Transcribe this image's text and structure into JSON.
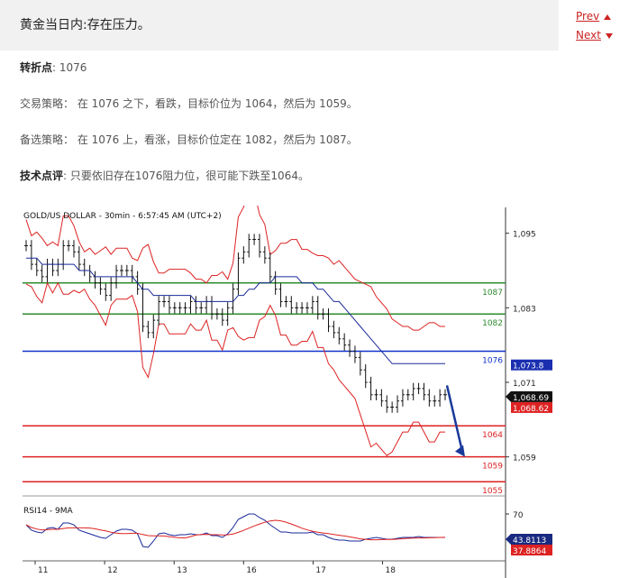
{
  "header": {
    "title": "黄金当日内:存在压力。",
    "prev_label": "Prev",
    "next_label": "Next"
  },
  "content": {
    "pivot_label": "转折点",
    "pivot_value": ": 1076",
    "strategy_label": "交易策略：",
    "strategy_text": "在 1076 之下，看跌，目标价位为 1064，然后为 1059。",
    "alt_label": "备选策略：",
    "alt_text": "在 1076 上，看涨，目标价位定在 1082，然后为 1087。",
    "tech_label": "技术点评",
    "tech_text": ": 只要依旧存在1076阻力位，很可能下跌至1064。"
  },
  "colors": {
    "accent": "#cc2222",
    "resistance": "#2e8b2e",
    "pivot": "#1133cc",
    "support": "#dd2222",
    "band": "#dd2222",
    "ma": "#1a2a99",
    "arrow": "#1a3a9a"
  },
  "chart_data": {
    "type": "line",
    "title": "GOLD/US DOLLAR - 30min - 6:57:45 AM (UTC+2)",
    "ylim": [
      1053,
      1098
    ],
    "yticks": [
      "1,095",
      "1,083",
      "1,071",
      "1,059"
    ],
    "ytick_values": [
      1095,
      1083,
      1071,
      1059
    ],
    "x_labels": [
      "11",
      "12",
      "13",
      "16",
      "17",
      "18"
    ],
    "x_label_positions": [
      2,
      16,
      30,
      44,
      58,
      72
    ],
    "n_bars": 80,
    "levels": [
      {
        "label": "1087",
        "value": 1087,
        "kind": "resistance"
      },
      {
        "label": "1082",
        "value": 1082,
        "kind": "resistance"
      },
      {
        "label": "1076",
        "value": 1076,
        "kind": "pivot"
      },
      {
        "label": "1064",
        "value": 1064,
        "kind": "support"
      },
      {
        "label": "1059",
        "value": 1059,
        "kind": "support"
      },
      {
        "label": "1055",
        "value": 1055,
        "kind": "support"
      }
    ],
    "price_tags": [
      {
        "label": "1,073.8",
        "value": 1073.8,
        "kind": "ma"
      },
      {
        "label": "1,068.69",
        "value": 1068.69,
        "kind": "last"
      },
      {
        "label": "1,068.62",
        "value": 1068.62,
        "kind": "band"
      }
    ],
    "close": [
      1093,
      1090,
      1089,
      1088,
      1090,
      1089,
      1090,
      1093,
      1093,
      1092,
      1090,
      1089,
      1088,
      1087,
      1086,
      1085,
      1087,
      1089,
      1089,
      1089,
      1088,
      1086,
      1080,
      1079,
      1081,
      1084,
      1084,
      1083,
      1083,
      1083,
      1083,
      1084,
      1083,
      1083,
      1084,
      1082,
      1082,
      1081,
      1083,
      1086,
      1091,
      1092,
      1094,
      1094,
      1092,
      1091,
      1088,
      1086,
      1084,
      1084,
      1083,
      1083,
      1083,
      1083,
      1084,
      1082,
      1082,
      1080,
      1079,
      1078,
      1077,
      1076,
      1075,
      1073,
      1071,
      1069,
      1069,
      1068,
      1067,
      1067,
      1068,
      1069,
      1069,
      1070,
      1070,
      1069,
      1068,
      1068,
      1069,
      1069
    ],
    "ma": [
      1091,
      1091,
      1091,
      1090,
      1090,
      1090,
      1090,
      1090,
      1090,
      1090,
      1089,
      1089,
      1089,
      1088,
      1088,
      1088,
      1088,
      1088,
      1088,
      1088,
      1088,
      1087,
      1086,
      1086,
      1085,
      1085,
      1085,
      1085,
      1085,
      1085,
      1085,
      1085,
      1084,
      1084,
      1084,
      1084,
      1084,
      1084,
      1084,
      1084,
      1085,
      1085,
      1086,
      1086,
      1087,
      1087,
      1087,
      1088,
      1088,
      1088,
      1088,
      1088,
      1087,
      1087,
      1087,
      1086,
      1086,
      1085,
      1084,
      1084,
      1083,
      1082,
      1081,
      1080,
      1079,
      1078,
      1077,
      1076,
      1075,
      1074,
      1074,
      1074,
      1074,
      1074,
      1074,
      1074,
      1074,
      1074,
      1074,
      1074
    ],
    "rsi": [
      58,
      52,
      50,
      49,
      54,
      55,
      53,
      60,
      60,
      58,
      52,
      50,
      48,
      46,
      44,
      43,
      47,
      51,
      53,
      53,
      52,
      48,
      34,
      33,
      40,
      48,
      49,
      47,
      46,
      47,
      47,
      48,
      47,
      47,
      49,
      46,
      46,
      44,
      48,
      55,
      64,
      67,
      70,
      70,
      66,
      63,
      58,
      54,
      50,
      50,
      49,
      49,
      49,
      49,
      50,
      47,
      47,
      44,
      42,
      41,
      41,
      40,
      40,
      40,
      42,
      43,
      44,
      43,
      42,
      42,
      43,
      44,
      44,
      44,
      45,
      44,
      44,
      44,
      44,
      44
    ],
    "rsi_label": "RSI14 - 9MA",
    "rsi_ticks": [
      "70"
    ],
    "rsi_tags": [
      {
        "label": "43.8113",
        "kind": "rsi"
      },
      {
        "label": "37.8864",
        "kind": "ma9"
      }
    ]
  }
}
